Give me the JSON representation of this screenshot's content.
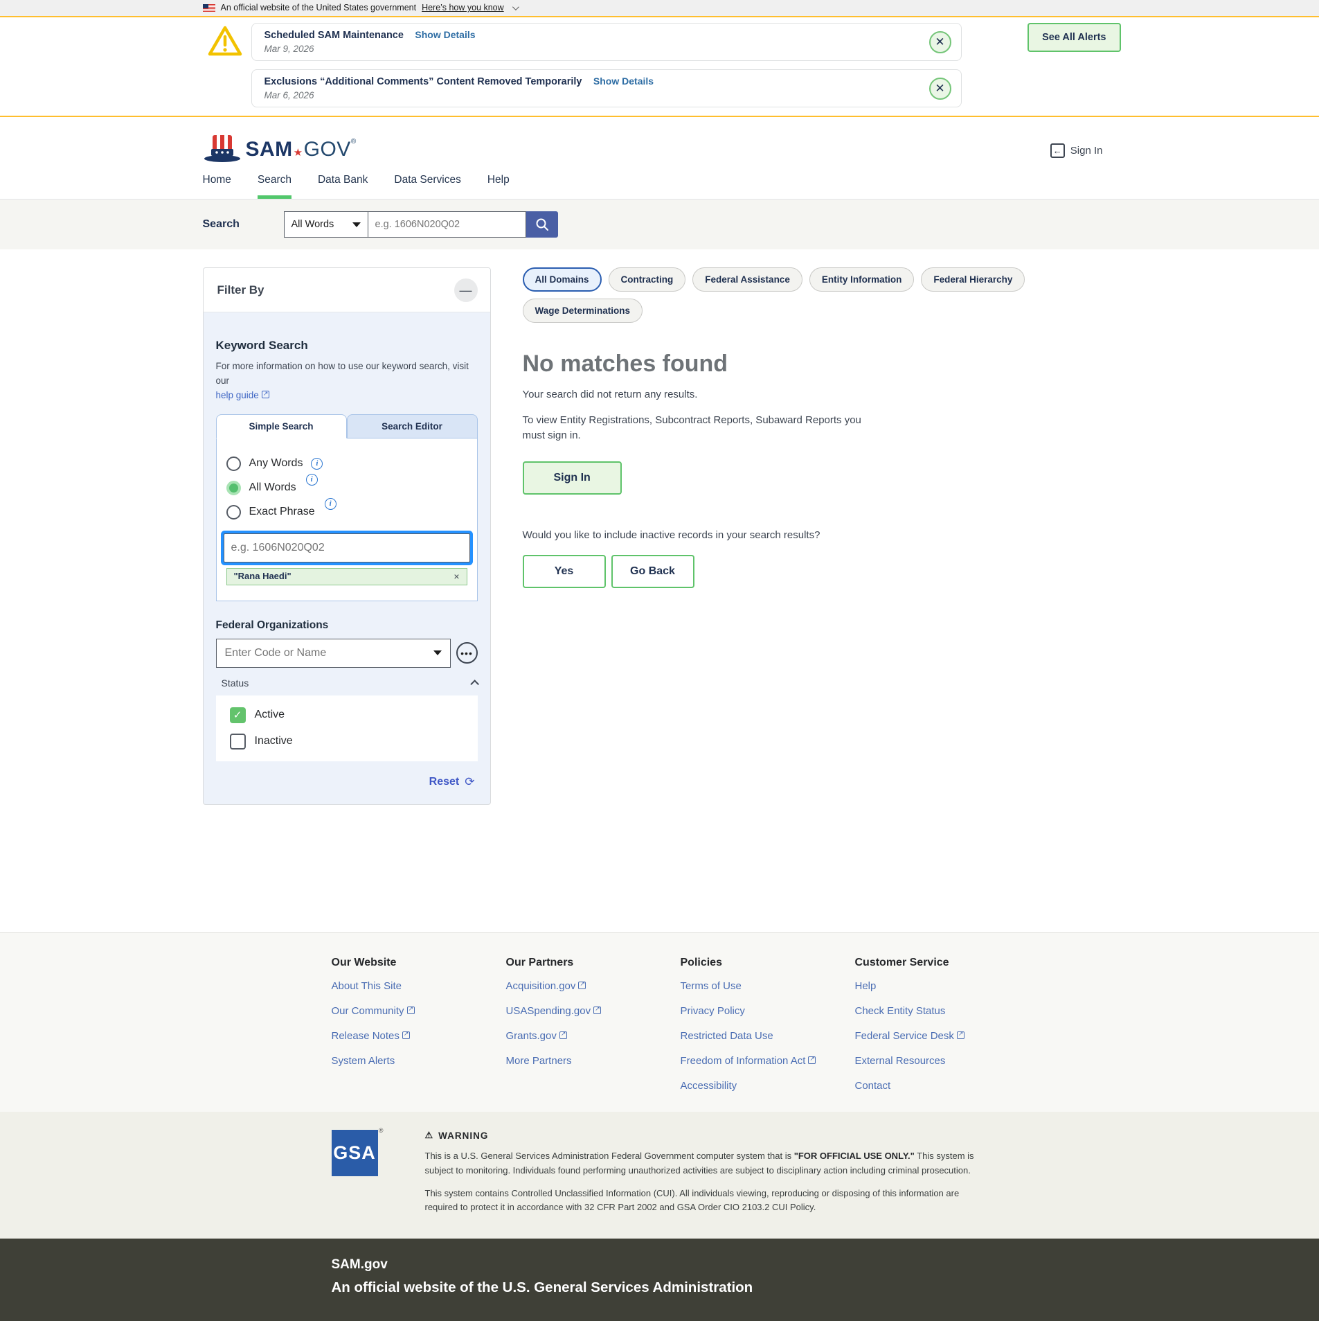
{
  "banner": {
    "text": "An official website of the United States government",
    "link": "Here’s how you know"
  },
  "alerts": {
    "items": [
      {
        "title": "Scheduled SAM Maintenance",
        "details_link": "Show Details",
        "date": "Mar 9, 2026"
      },
      {
        "title": "Exclusions “Additional Comments” Content Removed Temporarily",
        "details_link": "Show Details",
        "date": "Mar 6, 2026"
      }
    ],
    "see_all_label": "See All Alerts"
  },
  "header": {
    "brand_sam": "SAM",
    "brand_star": "★",
    "brand_gov": "GOV",
    "reg_mark": "®",
    "sign_in_label": "Sign In"
  },
  "nav": {
    "items": [
      {
        "label": "Home"
      },
      {
        "label": "Search"
      },
      {
        "label": "Data Bank"
      },
      {
        "label": "Data Services"
      },
      {
        "label": "Help"
      }
    ]
  },
  "searchbar": {
    "label": "Search",
    "mode_value": "All Words",
    "placeholder": "e.g. 1606N020Q02"
  },
  "filter": {
    "title": "Filter By",
    "keyword_heading": "Keyword Search",
    "keyword_help_text": "For more information on how to use our keyword search, visit our",
    "keyword_help_link": "help guide",
    "tabs": [
      {
        "label": "Simple Search"
      },
      {
        "label": "Search Editor"
      }
    ],
    "radios": [
      {
        "label": "Any Words",
        "selected": false
      },
      {
        "label": "All Words",
        "selected": true
      },
      {
        "label": "Exact Phrase",
        "selected": false
      }
    ],
    "keyword_placeholder": "e.g. 1606N020Q02",
    "chip": {
      "label": "\"Rana Haedi\"",
      "remove": "×"
    },
    "federal_orgs_heading": "Federal Organizations",
    "federal_orgs_placeholder": "Enter Code or Name",
    "status_label": "Status",
    "checkboxes": [
      {
        "label": "Active",
        "checked": true
      },
      {
        "label": "Inactive",
        "checked": false
      }
    ],
    "reset_label": "Reset"
  },
  "results": {
    "domains": [
      {
        "label": "All Domains",
        "active": true
      },
      {
        "label": "Contracting",
        "active": false
      },
      {
        "label": "Federal Assistance",
        "active": false
      },
      {
        "label": "Entity Information",
        "active": false
      },
      {
        "label": "Federal Hierarchy",
        "active": false
      },
      {
        "label": "Wage Determinations",
        "active": false
      }
    ],
    "heading": "No matches found",
    "message1": "Your search did not return any results.",
    "message2": "To view Entity Registrations, Subcontract Reports, Subaward Reports you must sign in.",
    "sign_in_label": "Sign In",
    "inactive_question": "Would you like to include inactive records in your search results?",
    "yes_label": "Yes",
    "go_back_label": "Go Back"
  },
  "footer": {
    "columns": [
      {
        "heading": "Our Website",
        "links": [
          {
            "label": "About This Site",
            "external": false
          },
          {
            "label": "Our Community",
            "external": true
          },
          {
            "label": "Release Notes",
            "external": true
          },
          {
            "label": "System Alerts",
            "external": false
          }
        ]
      },
      {
        "heading": "Our Partners",
        "links": [
          {
            "label": "Acquisition.gov",
            "external": true
          },
          {
            "label": "USASpending.gov",
            "external": true
          },
          {
            "label": "Grants.gov",
            "external": true
          },
          {
            "label": "More Partners",
            "external": false
          }
        ]
      },
      {
        "heading": "Policies",
        "links": [
          {
            "label": "Terms of Use",
            "external": false
          },
          {
            "label": "Privacy Policy",
            "external": false
          },
          {
            "label": "Restricted Data Use",
            "external": false
          },
          {
            "label": "Freedom of Information Act",
            "external": true
          },
          {
            "label": "Accessibility",
            "external": false
          }
        ]
      },
      {
        "heading": "Customer Service",
        "links": [
          {
            "label": "Help",
            "external": false
          },
          {
            "label": "Check Entity Status",
            "external": false
          },
          {
            "label": "Federal Service Desk",
            "external": true
          },
          {
            "label": "External Resources",
            "external": false
          },
          {
            "label": "Contact",
            "external": false
          }
        ]
      }
    ],
    "gsa_logo": "GSA",
    "warning_title": "WARNING",
    "warning_p1_pre": "This is a U.S. General Services Administration Federal Government computer system that is ",
    "warning_p1_bold": "\"FOR OFFICIAL USE ONLY.\"",
    "warning_p1_post": " This system is subject to monitoring. Individuals found performing unauthorized activities are subject to disciplinary action including criminal prosecution.",
    "warning_p2": "This system contains Controlled Unclassified Information (CUI). All individuals viewing, reproducing or disposing of this information are required to protect it in accordance with 32 CFR Part 2002 and GSA Order CIO 2103.2 CUI Policy.",
    "dark": {
      "brand": "SAM.gov",
      "tagline": "An official website of the U.S. General Services Administration"
    }
  },
  "colors": {
    "gold_accent": "#ffbe2e",
    "green_accent": "#5fc36a",
    "nav_active_green": "#52c76c",
    "search_button_indigo": "#4a5fa5",
    "focus_blue": "#2491ff",
    "link_blue": "#4a6db3",
    "pill_active_border": "#2a5db0",
    "gsa_blue": "#2a5ca8",
    "dark_footer_bg": "#3f4037"
  }
}
